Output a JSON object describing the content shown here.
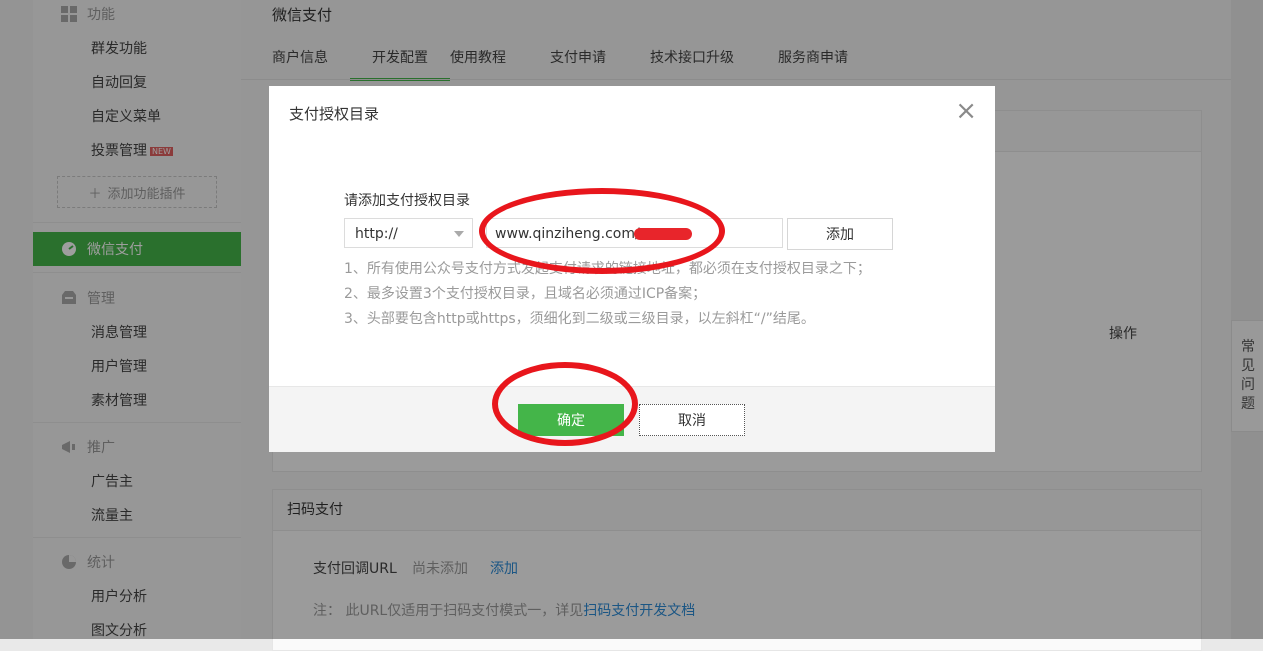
{
  "sidebar": {
    "group_function": "功能",
    "function_items": [
      "群发功能",
      "自动回复",
      "自定义菜单",
      "投票管理"
    ],
    "new_badge": "NEW",
    "add_plugin": "添加功能插件",
    "active_item": "微信支付",
    "group_manage": "管理",
    "manage_items": [
      "消息管理",
      "用户管理",
      "素材管理"
    ],
    "group_promote": "推广",
    "promote_items": [
      "广告主",
      "流量主"
    ],
    "group_stats": "统计",
    "stats_items": [
      "用户分析",
      "图文分析"
    ]
  },
  "main": {
    "page_title": "微信支付",
    "tabs": [
      "商户信息",
      "开发配置",
      "使用教程",
      "支付申请",
      "技术接口升级",
      "服务商申请"
    ],
    "active_tab": "开发配置",
    "bg_table_col_action": "操作",
    "scan_panel_title": "扫码支付",
    "scan_callback_label": "支付回调URL",
    "scan_callback_value": "尚未添加",
    "scan_callback_add": "添加",
    "scan_note_prefix": "注： 此URL仅适用于扫码支付模式一，详见",
    "scan_note_link": "扫码支付开发文档"
  },
  "right_tab": {
    "chars": [
      "常",
      "见",
      "问",
      "题"
    ]
  },
  "modal": {
    "title": "支付授权目录",
    "close_glyph": "×",
    "prompt": "请添加支付授权目录",
    "protocol_selected": "http://",
    "url_value": "www.qinziheng.com/",
    "add_label": "添加",
    "notes": [
      "1、所有使用公众号支付方式发起支付请求的链接地址，都必须在支付授权目录之下；",
      "2、最多设置3个支付授权目录，且域名必须通过ICP备案；",
      "3、头部要包含http或https，须细化到二级或三级目录，以左斜杠“/”结尾。"
    ],
    "confirm_label": "确定",
    "cancel_label": "取消"
  },
  "colors": {
    "accent": "#44b549",
    "annotation": "#e8161c",
    "link": "#2c8bd6"
  }
}
